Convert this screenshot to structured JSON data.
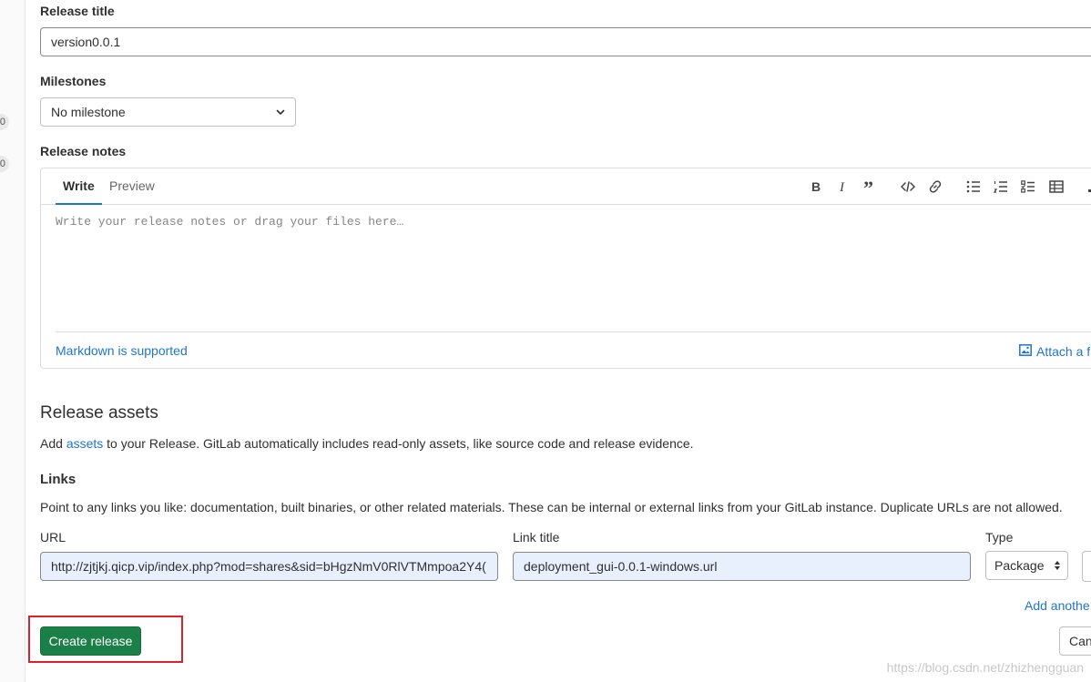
{
  "sidebar": {
    "badges": [
      "0",
      "0"
    ]
  },
  "release_title": {
    "label": "Release title",
    "value": "version0.0.1"
  },
  "milestones": {
    "label": "Milestones",
    "selected": "No milestone"
  },
  "release_notes": {
    "label": "Release notes",
    "tabs": [
      "Write",
      "Preview"
    ],
    "placeholder": "Write your release notes or drag your files here…",
    "markdown_link": "Markdown is supported",
    "attach_link": "Attach a f",
    "toolbar_icons": [
      "bold-icon",
      "italic-icon",
      "quote-icon",
      "code-icon",
      "link-icon",
      "bullet-list-icon",
      "numbered-list-icon",
      "task-list-icon",
      "table-icon",
      "fullscreen-icon"
    ]
  },
  "assets": {
    "heading": "Release assets",
    "desc_before": "Add ",
    "desc_link": "assets",
    "desc_after": " to your Release. GitLab automatically includes read-only assets, like source code and release evidence."
  },
  "links": {
    "heading": "Links",
    "desc": "Point to any links you like: documentation, built binaries, or other related materials. These can be internal or external links from your GitLab instance. Duplicate URLs are not allowed.",
    "url_label": "URL",
    "url_value": "http://zjtjkj.qicp.vip/index.php?mod=shares&sid=bHgzNmV0RlVTMmpoa2Y4(",
    "title_label": "Link title",
    "title_value": "deployment_gui-0.0.1-windows.url",
    "type_label": "Type",
    "type_value": "Package",
    "add_another": "Add anothe"
  },
  "actions": {
    "create": "Create release",
    "cancel": "Can"
  },
  "watermark": "https://blog.csdn.net/zhizhengguan",
  "colors": {
    "primary_button": "#1b8048",
    "link": "#1f75cb",
    "highlight": "#d9222b"
  }
}
